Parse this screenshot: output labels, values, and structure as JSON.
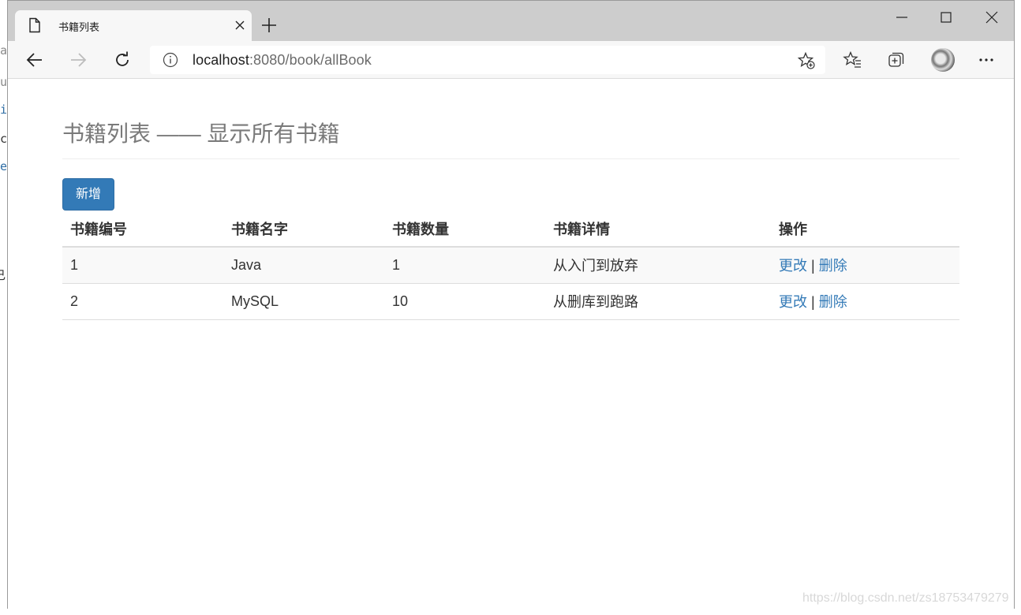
{
  "browser": {
    "tab_title": "书籍列表",
    "url_host": "localhost",
    "url_rest": ":8080/book/allBook"
  },
  "background_editor": {
    "fragments": [
      "a",
      "u",
      "i",
      "c",
      "e",
      "己"
    ]
  },
  "page": {
    "title": "书籍列表 —— 显示所有书籍",
    "add_button": "新增",
    "columns": [
      "书籍编号",
      "书籍名字",
      "书籍数量",
      "书籍详情",
      "操作"
    ],
    "rows": [
      {
        "id": "1",
        "name": "Java",
        "count": "1",
        "detail": "从入门到放弃",
        "edit": "更改",
        "sep": "|",
        "delete": "删除"
      },
      {
        "id": "2",
        "name": "MySQL",
        "count": "10",
        "detail": "从删库到跑路",
        "edit": "更改",
        "sep": "|",
        "delete": "删除"
      }
    ]
  },
  "watermark": "https://blog.csdn.net/zs18753479279",
  "colors": {
    "primary": "#337ab7",
    "title_gray": "#7a7a7a",
    "titlebar": "#cdcdcd",
    "toolbar": "#f7f7f7"
  }
}
